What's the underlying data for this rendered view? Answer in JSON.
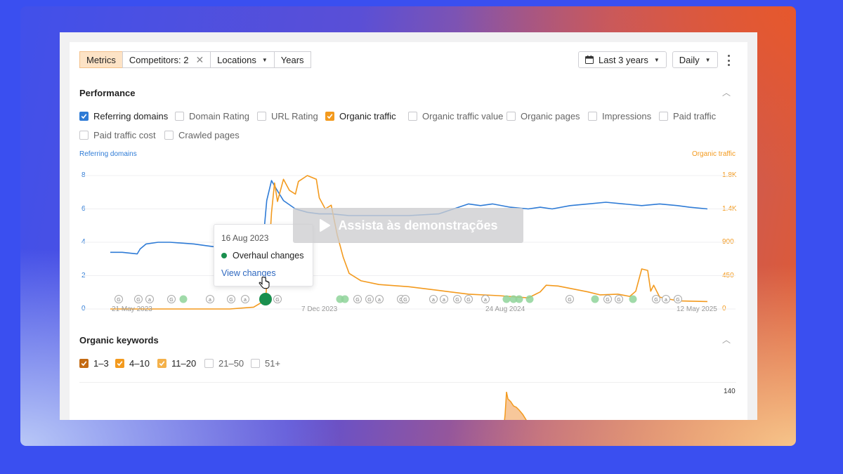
{
  "toolbar": {
    "metrics": "Metrics",
    "competitors": "Competitors: 2",
    "locations": "Locations",
    "years": "Years",
    "date_range": "Last 3 years",
    "granularity": "Daily"
  },
  "performance": {
    "title": "Performance",
    "checkboxes": [
      {
        "label": "Referring domains",
        "checked": true,
        "color": "#2e7bd6"
      },
      {
        "label": "Domain Rating",
        "checked": false
      },
      {
        "label": "URL Rating",
        "checked": false
      },
      {
        "label": "Organic traffic",
        "checked": true,
        "color": "#f39a1e"
      },
      {
        "label": "Organic traffic value",
        "checked": false
      },
      {
        "label": "Organic pages",
        "checked": false
      },
      {
        "label": "Impressions",
        "checked": false
      },
      {
        "label": "Paid traffic",
        "checked": false
      },
      {
        "label": "Paid traffic cost",
        "checked": false
      },
      {
        "label": "Crawled pages",
        "checked": false
      }
    ]
  },
  "chart_data": {
    "type": "line",
    "left_axis_title": "Referring domains",
    "right_axis_title": "Organic traffic",
    "left_ticks": [
      "8",
      "6",
      "4",
      "2",
      "0"
    ],
    "right_ticks": [
      "1.8K",
      "1.4K",
      "900",
      "450",
      "0"
    ],
    "left_range": [
      0,
      8
    ],
    "right_range": [
      0,
      1800
    ],
    "x_labels": [
      "21 May 2023",
      "7 Dec 2023",
      "24 Aug 2024",
      "12 May 2025"
    ],
    "grid": true,
    "series": [
      {
        "name": "Referring domains",
        "color": "#2e7bd6",
        "axis": "left",
        "points": [
          [
            0,
            3.4
          ],
          [
            0.02,
            3.4
          ],
          [
            0.045,
            3.3
          ],
          [
            0.05,
            3.6
          ],
          [
            0.06,
            3.9
          ],
          [
            0.08,
            4.0
          ],
          [
            0.1,
            4.0
          ],
          [
            0.14,
            3.9
          ],
          [
            0.16,
            3.8
          ],
          [
            0.18,
            3.7
          ],
          [
            0.22,
            3.6
          ],
          [
            0.24,
            3.6
          ],
          [
            0.255,
            3.7
          ],
          [
            0.262,
            6.5
          ],
          [
            0.27,
            7.7
          ],
          [
            0.278,
            7.2
          ],
          [
            0.29,
            6.5
          ],
          [
            0.31,
            6.0
          ],
          [
            0.33,
            5.8
          ],
          [
            0.35,
            5.7
          ],
          [
            0.37,
            5.7
          ],
          [
            0.4,
            5.6
          ],
          [
            0.45,
            5.6
          ],
          [
            0.5,
            5.6
          ],
          [
            0.55,
            5.7
          ],
          [
            0.6,
            6.3
          ],
          [
            0.62,
            6.2
          ],
          [
            0.64,
            6.3
          ],
          [
            0.67,
            6.1
          ],
          [
            0.7,
            6.0
          ],
          [
            0.72,
            6.1
          ],
          [
            0.74,
            6.0
          ],
          [
            0.77,
            6.2
          ],
          [
            0.8,
            6.3
          ],
          [
            0.83,
            6.4
          ],
          [
            0.86,
            6.3
          ],
          [
            0.89,
            6.2
          ],
          [
            0.92,
            6.3
          ],
          [
            0.95,
            6.2
          ],
          [
            0.97,
            6.1
          ],
          [
            1.0,
            6.0
          ]
        ]
      },
      {
        "name": "Organic traffic",
        "color": "#f39a1e",
        "axis": "right",
        "points": [
          [
            0,
            0
          ],
          [
            0.2,
            0
          ],
          [
            0.24,
            25
          ],
          [
            0.26,
            120
          ],
          [
            0.265,
            650
          ],
          [
            0.27,
            1300
          ],
          [
            0.275,
            1700
          ],
          [
            0.28,
            1450
          ],
          [
            0.29,
            1750
          ],
          [
            0.3,
            1600
          ],
          [
            0.31,
            1550
          ],
          [
            0.315,
            1720
          ],
          [
            0.33,
            1800
          ],
          [
            0.345,
            1750
          ],
          [
            0.35,
            1500
          ],
          [
            0.36,
            1350
          ],
          [
            0.37,
            1400
          ],
          [
            0.38,
            1000
          ],
          [
            0.39,
            700
          ],
          [
            0.4,
            480
          ],
          [
            0.42,
            380
          ],
          [
            0.45,
            330
          ],
          [
            0.5,
            300
          ],
          [
            0.55,
            250
          ],
          [
            0.6,
            200
          ],
          [
            0.65,
            180
          ],
          [
            0.7,
            150
          ],
          [
            0.72,
            230
          ],
          [
            0.73,
            320
          ],
          [
            0.75,
            310
          ],
          [
            0.8,
            230
          ],
          [
            0.82,
            190
          ],
          [
            0.85,
            200
          ],
          [
            0.87,
            170
          ],
          [
            0.88,
            240
          ],
          [
            0.89,
            540
          ],
          [
            0.9,
            520
          ],
          [
            0.905,
            240
          ],
          [
            0.91,
            320
          ],
          [
            0.92,
            160
          ],
          [
            0.95,
            110
          ],
          [
            1.0,
            100
          ]
        ]
      }
    ],
    "annotations": [
      {
        "date": "16 Aug 2023",
        "label": "Overhaul changes",
        "link": "View changes"
      }
    ]
  },
  "organic_keywords": {
    "title": "Organic keywords",
    "checkboxes": [
      {
        "label": "1–3",
        "checked": true,
        "color": "#c46a12"
      },
      {
        "label": "4–10",
        "checked": true,
        "color": "#f39a1e"
      },
      {
        "label": "11–20",
        "checked": true,
        "color": "#f4b14a"
      },
      {
        "label": "21–50",
        "checked": false
      },
      {
        "label": "51+",
        "checked": false
      }
    ],
    "right_tick": "140"
  },
  "video_overlay": {
    "label": "Assista às demonstrações"
  },
  "icons": {
    "calendar": "calendar-icon",
    "more": "more-vertical-icon",
    "close": "close-icon",
    "play": "play-icon",
    "cursor": "hand-pointer-icon"
  },
  "colors": {
    "blue": "#2e7bd6",
    "orange": "#f39a1e",
    "green": "#1a8f4e",
    "active_tab_bg": "#fde3c6"
  }
}
